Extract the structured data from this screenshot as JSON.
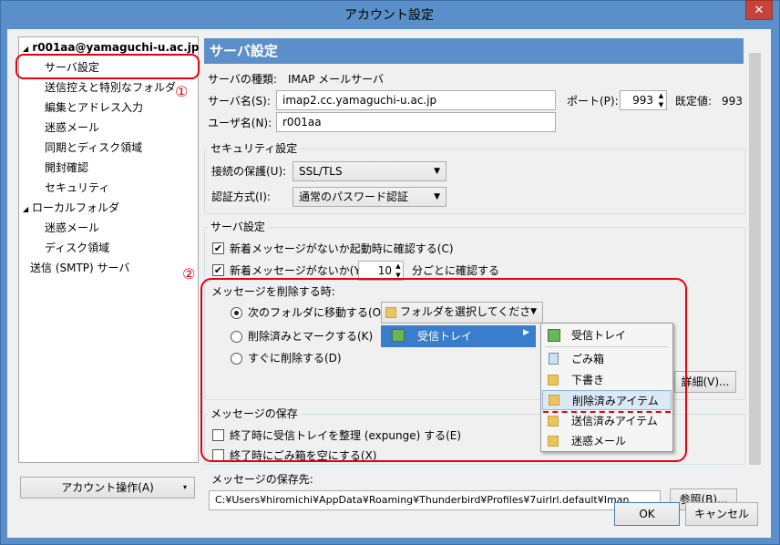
{
  "window": {
    "title": "アカウント設定",
    "close_glyph": "✕"
  },
  "tree": {
    "account": "r001aa@yamaguchi-u.ac.jp",
    "items": [
      "サーバ設定",
      "送信控えと特別なフォルダ",
      "編集とアドレス入力",
      "迷惑メール",
      "同期とディスク領域",
      "開封確認",
      "セキュリティ"
    ],
    "local": "ローカルフォルダ",
    "local_items": [
      "迷惑メール",
      "ディスク領域"
    ],
    "smtp": "送信 (SMTP) サーバ"
  },
  "account_actions": "アカウント操作(A)",
  "panel": {
    "header": "サーバ設定",
    "server_type_label": "サーバの種類:",
    "server_type": "IMAP メールサーバ",
    "server_name_label": "サーバ名(S):",
    "server_name": "imap2.cc.yamaguchi-u.ac.jp",
    "port_label": "ポート(P):",
    "port": "993",
    "default_label": "既定値:",
    "default_value": "993",
    "username_label": "ユーザ名(N):",
    "username": "r001aa",
    "security_title": "セキュリティ設定",
    "conn_label": "接続の保護(U):",
    "conn_value": "SSL/TLS",
    "auth_label": "認証方式(I):",
    "auth_value": "通常のパスワード認証",
    "server_settings_title": "サーバ設定",
    "check_startup": "新着メッセージがないか起動時に確認する(C)",
    "check_every": "新着メッセージがないか(Y)",
    "minutes": "10",
    "minutes_suffix": "分ごとに確認する",
    "delete_title": "メッセージを削除する時:",
    "move_to": "次のフォルダに移動する(O):",
    "folder_select": "フォルダを選択してください...",
    "mark_deleted": "削除済みとマークする(K)",
    "delete_now": "すぐに削除する(D)",
    "advanced": "詳細(V)...",
    "store_title": "メッセージの保存",
    "expunge": "終了時に受信トレイを整理 (expunge) する(E)",
    "empty_trash": "終了時にごみ箱を空にする(X)",
    "store_path_label": "メッセージの保存先:",
    "store_path": "C:¥Users¥hiromichi¥AppData¥Roaming¥Thunderbird¥Profiles¥7uirlrl.default¥Iman",
    "browse": "参照(B)..."
  },
  "menu": {
    "inbox": "受信トレイ",
    "submenu": [
      "受信トレイ",
      "ごみ箱",
      "下書き",
      "削除済みアイテム",
      "送信済みアイテム",
      "迷惑メール"
    ]
  },
  "annotations": {
    "one": "①",
    "two": "②"
  },
  "buttons": {
    "ok": "OK",
    "cancel": "キャンセル"
  }
}
